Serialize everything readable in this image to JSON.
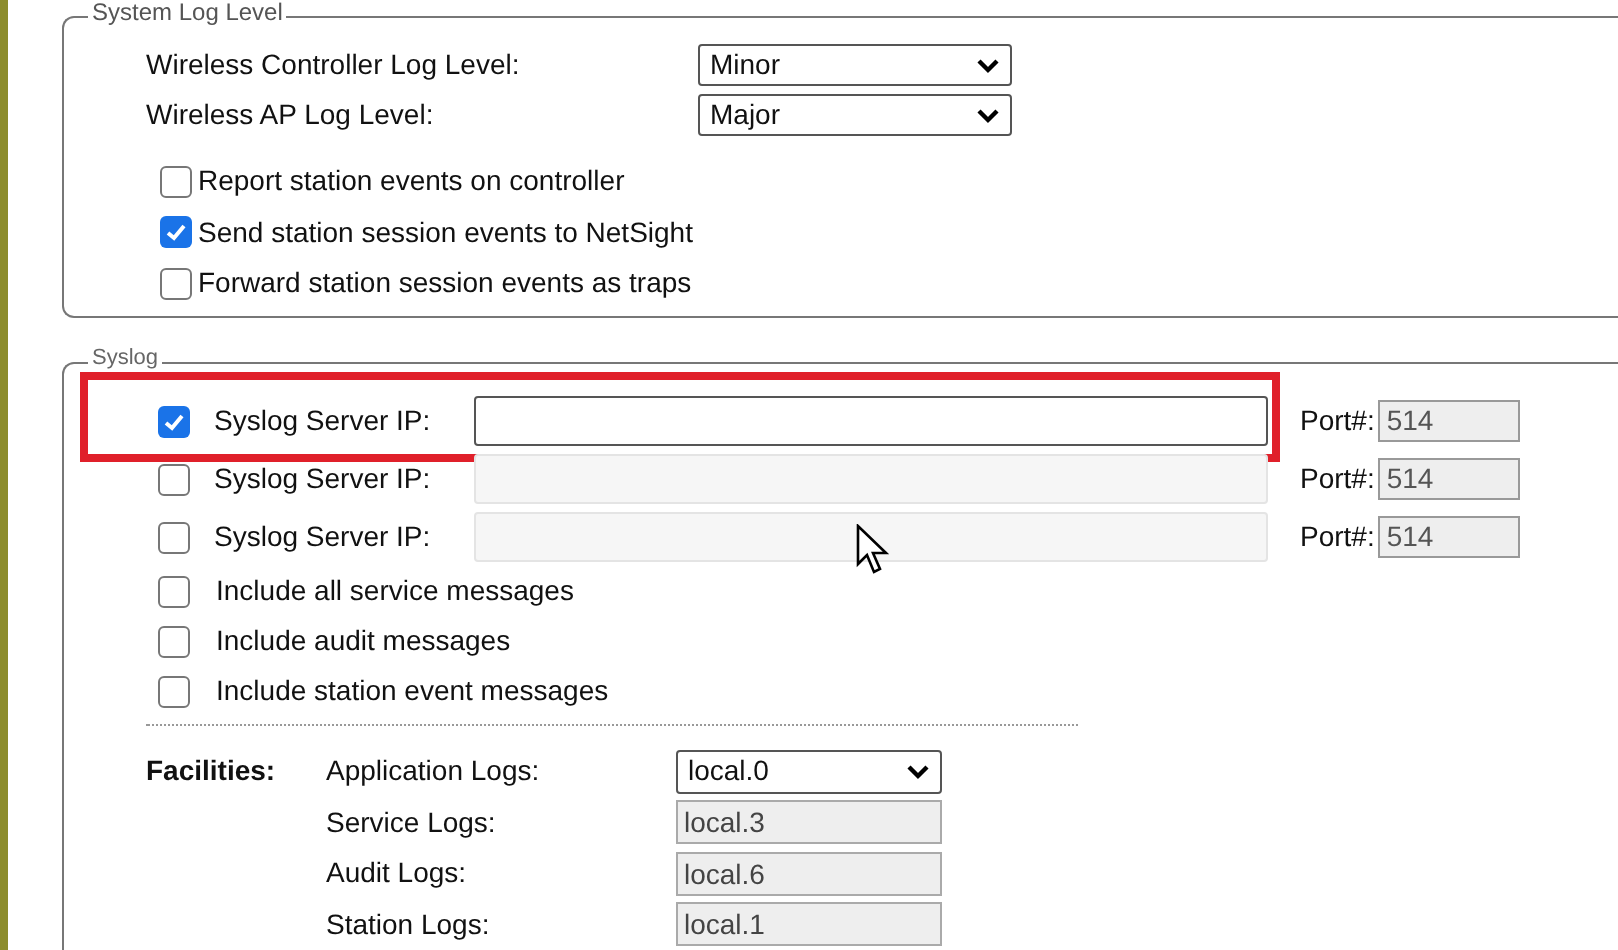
{
  "system_log_level": {
    "legend": "System Log Level",
    "levels": [
      {
        "label": "Wireless Controller Log Level:",
        "value": "Minor"
      },
      {
        "label": "Wireless AP Log Level:",
        "value": "Major"
      }
    ],
    "options": [
      {
        "label": "Report station events on controller",
        "checked": false
      },
      {
        "label": "Send station session events to NetSight",
        "checked": true
      },
      {
        "label": "Forward station session events as traps",
        "checked": false
      }
    ]
  },
  "syslog": {
    "legend": "Syslog",
    "servers": [
      {
        "checked": true,
        "label": "Syslog Server IP:",
        "port_label": "Port#:",
        "port": "514",
        "highlighted": true
      },
      {
        "checked": false,
        "label": "Syslog Server IP:",
        "port_label": "Port#:",
        "port": "514",
        "highlighted": false
      },
      {
        "checked": false,
        "label": "Syslog Server IP:",
        "port_label": "Port#:",
        "port": "514",
        "highlighted": false
      }
    ],
    "options": [
      {
        "label": "Include all service messages",
        "checked": false
      },
      {
        "label": "Include audit messages",
        "checked": false
      },
      {
        "label": "Include station event messages",
        "checked": false
      }
    ],
    "facilities_label": "Facilities:",
    "facilities": [
      {
        "kind": "select",
        "label": "Application Logs:",
        "value": "local.0"
      },
      {
        "kind": "readonly",
        "label": "Service Logs:",
        "value": "local.3"
      },
      {
        "kind": "readonly",
        "label": "Audit Logs:",
        "value": "local.6"
      },
      {
        "kind": "readonly",
        "label": "Station Logs:",
        "value": "local.1"
      }
    ]
  }
}
